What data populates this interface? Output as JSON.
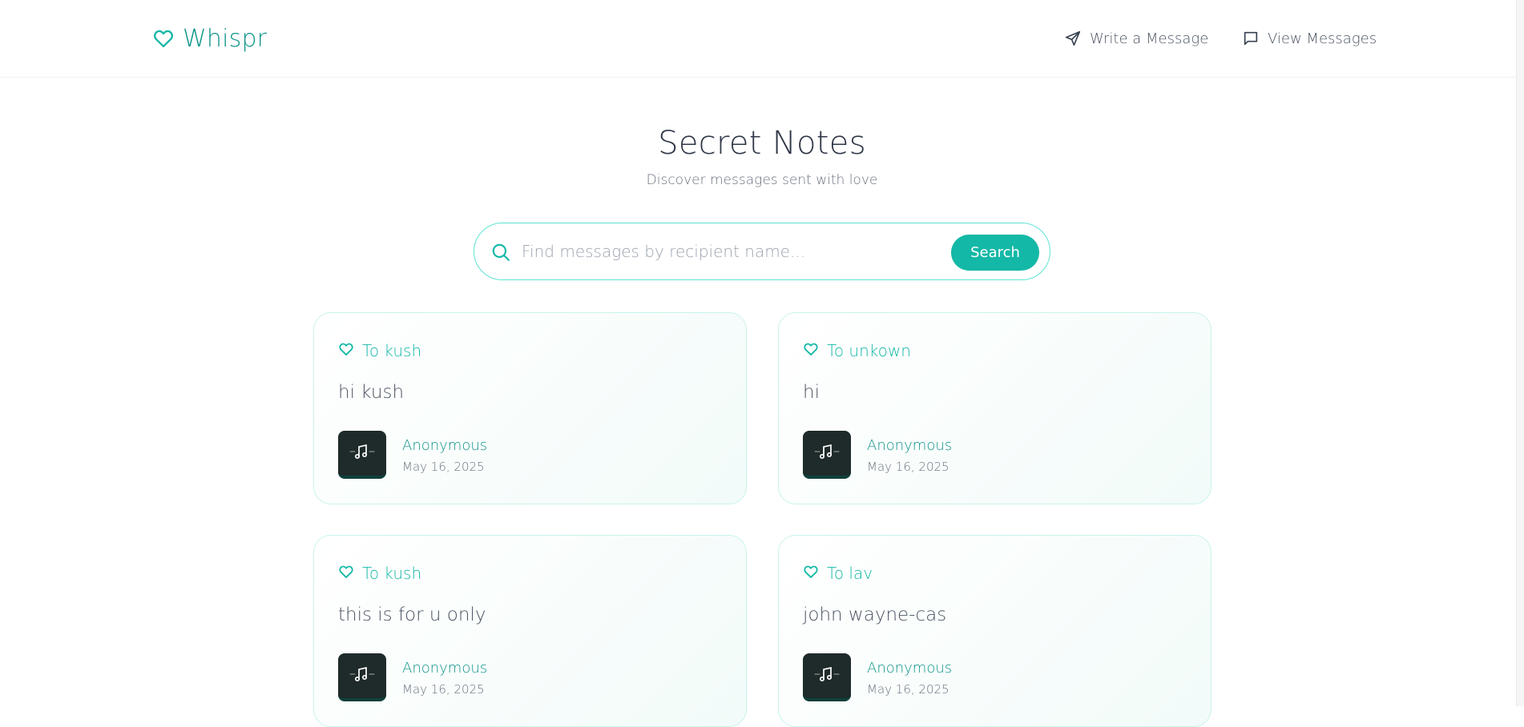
{
  "header": {
    "brand": "Whispr",
    "nav": {
      "write_label": "Write a Message",
      "view_label": "View Messages"
    }
  },
  "hero": {
    "title": "Secret Notes",
    "subtitle": "Discover messages sent with love"
  },
  "search": {
    "placeholder": "Find messages by recipient name...",
    "value": "",
    "button_label": "Search"
  },
  "notes": [
    {
      "to": "To kush",
      "message": "hi kush",
      "author": "Anonymous",
      "date": "May 16, 2025"
    },
    {
      "to": "To unkown",
      "message": "hi",
      "author": "Anonymous",
      "date": "May 16, 2025"
    },
    {
      "to": "To kush",
      "message": "this is for u only",
      "author": "Anonymous",
      "date": "May 16, 2025"
    },
    {
      "to": "To lav",
      "message": "john wayne-cas",
      "author": "Anonymous",
      "date": "May 16, 2025"
    }
  ],
  "colors": {
    "accent": "#14b8a6",
    "brand": "#0d9488",
    "card_border": "#c9f3ec"
  },
  "icons": {
    "brand": "heart-icon",
    "write": "send-icon",
    "view": "message-icon",
    "search": "search-icon",
    "player": "music-icon"
  }
}
